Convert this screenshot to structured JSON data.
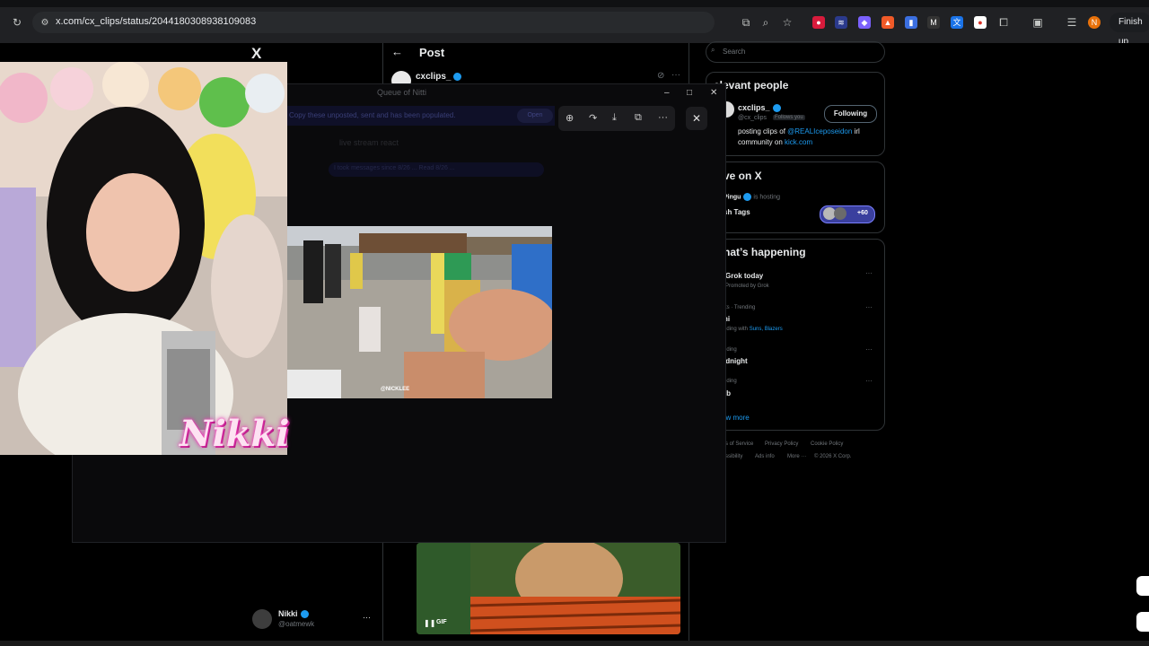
{
  "browser": {
    "url": "x.com/cx_clips/status/2044180308938109083",
    "finish_update": "Finish up"
  },
  "x": {
    "logo": "X",
    "post_header": "Post",
    "post_author": "cxclips_",
    "search_placeholder": "Search",
    "relevant_people": {
      "title": "elevant people",
      "name": "cxclips_",
      "handle": "@cx_clips",
      "follows_you": "Follows you",
      "follow_state": "Following",
      "bio_prefix": "posting clips of ",
      "bio_mention": "@REALIceposeidon",
      "bio_middle": " irl",
      "bio_line2_prefix": "community on ",
      "bio_link": "kick.com"
    },
    "live": {
      "title": "ve on X",
      "host_name": "Pingu",
      "host_status": "is hosting",
      "space_title": "sh Tags",
      "listeners": "+60"
    },
    "happening": {
      "title": "hat’s happening",
      "items": [
        {
          "context": "Grok today",
          "sub": "Promoted by Grok"
        },
        {
          "context": "rts · Trending",
          "title": "ni",
          "sub_prefix": "nding with ",
          "sub_links": "Suns, Blazers"
        },
        {
          "context": "nding",
          "title": "idnight"
        },
        {
          "context": "nding",
          "title": "rb"
        }
      ],
      "show_more": "ow more"
    },
    "footer": {
      "line1": [
        "s of Service",
        "Privacy Policy",
        "Cookie Policy"
      ],
      "line2": [
        "ssibility",
        "Ads info",
        "More ···",
        "© 2026 X Corp."
      ]
    },
    "account": {
      "name": "Nikki",
      "handle": "@oatmewk"
    },
    "gif_label": "GIF"
  },
  "popup": {
    "title": "Queue of Nitti",
    "notice": "Copy these unposted, sent and has been populated.",
    "notice_button": "Open",
    "dim_header": "live stream react",
    "dim_bubble": "I took messages since 8/26 ... Read 8/26 ..."
  },
  "video": {
    "watermark": "@NICKLEE"
  },
  "overlay": {
    "streamer_logo": "Nikki"
  },
  "colors": {
    "x_blue": "#1d9bf0",
    "browser_bar": "#202124",
    "border": "#2f3336"
  }
}
